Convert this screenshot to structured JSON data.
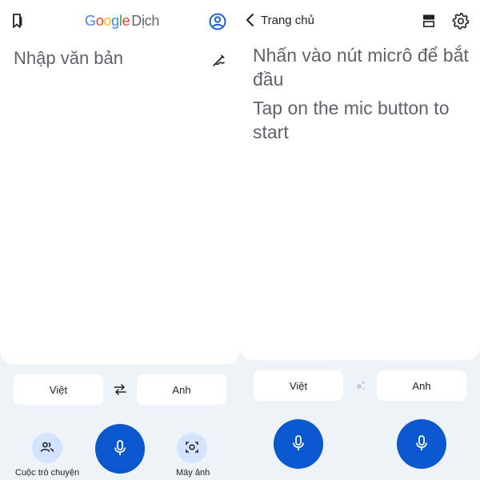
{
  "left": {
    "logo": {
      "g1": "G",
      "g2": "o",
      "g3": "o",
      "g4": "g",
      "g5": "l",
      "g6": "e",
      "dich": "Dịch"
    },
    "input_placeholder": "Nhập văn bản",
    "source_lang": "Việt",
    "target_lang": "Anh",
    "conversation_label": "Cuộc trò chuyện",
    "camera_label": "Máy ảnh"
  },
  "right": {
    "back_label": "Trang chủ",
    "prompt_vi": "Nhấn vào nút micrô để bắt đầu",
    "prompt_en": "Tap on the mic button to start",
    "source_lang": "Việt",
    "target_lang": "Anh"
  },
  "colors": {
    "accent": "#0b57d0",
    "tonal": "#d3e3fd",
    "background": "#eef2f9"
  },
  "icons": [
    "bookmark-icon",
    "account-icon",
    "handwrite-icon",
    "swap-icon",
    "mic-icon",
    "people-icon",
    "camera-icon",
    "back-icon",
    "layout-icon",
    "settings-icon",
    "sparkle-icon"
  ]
}
